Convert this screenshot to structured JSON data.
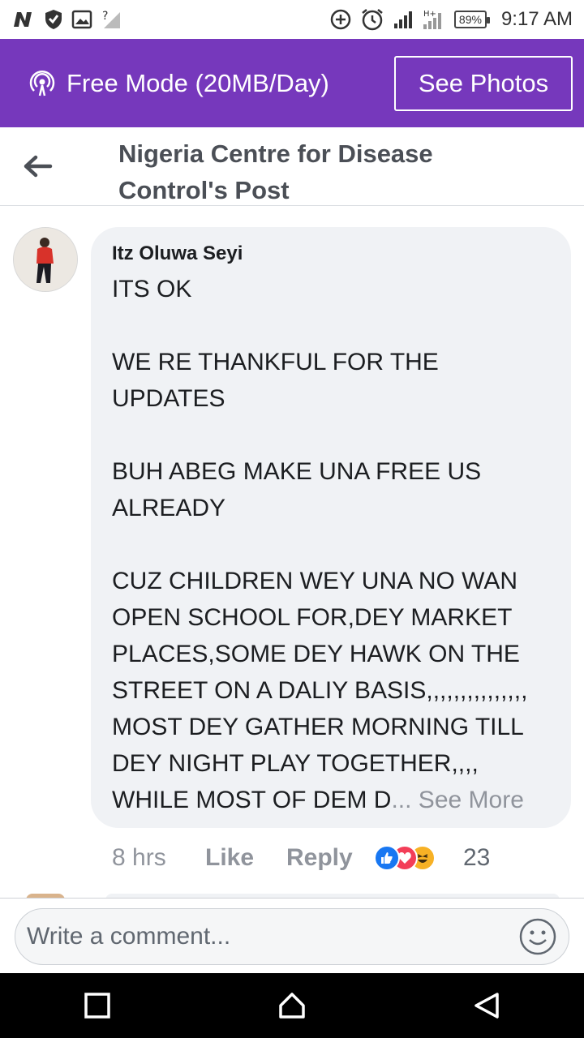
{
  "status_bar": {
    "time": "9:17 AM",
    "battery": "89%",
    "icons": [
      "n-notification-icon",
      "shield-icon",
      "image-icon",
      "no-signal-icon",
      "add-circle-icon",
      "alarm-icon",
      "signal-icon",
      "signal-ht-icon",
      "battery-icon"
    ]
  },
  "free_mode": {
    "label": "Free Mode (20MB/Day)",
    "button": "See Photos",
    "icon": "broadcast-icon",
    "color": "#7638bc"
  },
  "header": {
    "title": "Nigeria Centre for Disease Control's Post",
    "back_icon": "back-arrow-icon"
  },
  "comment": {
    "author": "Itz Oluwa Seyi",
    "paragraphs": [
      "ITS OK",
      "WE RE THANKFUL FOR THE UPDATES",
      "BUH ABEG MAKE UNA FREE US ALREADY",
      "CUZ CHILDREN WEY UNA NO WAN OPEN SCHOOL FOR,DEY MARKET PLACES,SOME DEY HAWK ON THE STREET ON A DALIY BASIS,,,,,,,,,,,,,,, MOST DEY GATHER MORNING TILL DEY NIGHT PLAY TOGETHER,,,, WHILE MOST OF DEM D"
    ],
    "see_more": "... See More",
    "time_ago": "8 hrs",
    "like": "Like",
    "reply": "Reply",
    "reaction_count": "23",
    "reactions": [
      "like-reaction-icon",
      "love-reaction-icon",
      "haha-reaction-icon"
    ]
  },
  "composer": {
    "placeholder": "Write a comment..."
  },
  "nav": [
    "recents-button",
    "home-button",
    "back-button"
  ]
}
